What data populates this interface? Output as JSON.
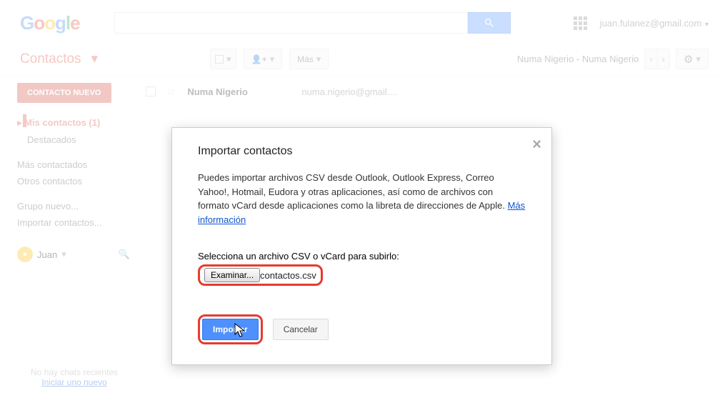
{
  "header": {
    "logo_text": "Google",
    "search_placeholder": "",
    "user_email": "juan.fulanez@gmail.com"
  },
  "app": {
    "title": "Contactos",
    "new_button": "CONTACTO NUEVO",
    "more_label": "Más"
  },
  "sidebar": {
    "items": [
      {
        "label": "Mis contactos (1)",
        "active": true,
        "sub": false
      },
      {
        "label": "Destacados",
        "active": false,
        "sub": true
      },
      {
        "label": "Más contactados",
        "active": false,
        "sub": false
      },
      {
        "label": "Otros contactos",
        "active": false,
        "sub": false
      },
      {
        "label": "Grupo nuevo...",
        "active": false,
        "sub": false
      },
      {
        "label": "Importar contactos...",
        "active": false,
        "sub": false
      }
    ],
    "user_name": "Juan"
  },
  "toolbar_right": {
    "range": "Numa Nigerio - Numa Nigerio"
  },
  "contacts": [
    {
      "name": "Numa Nigerio",
      "email": "numa.nigerio@gmail...."
    }
  ],
  "chat": {
    "no_recent": "No hay chats recientes",
    "start_new": "Iniciar uno nuevo"
  },
  "dialog": {
    "title": "Importar contactos",
    "body_1": "Puedes importar archivos CSV desde Outlook, Outlook Express, Correo Yahoo!, Hotmail, Eudora y otras aplicaciones, así como de archivos con formato vCard desde aplicaciones como la libreta de direcciones de Apple.  ",
    "more_info": "Más información",
    "select_label": "Selecciona un archivo CSV o vCard para subirlo:",
    "browse_label": "Examinar...",
    "filename": "contactos.csv",
    "import_btn": "Importar",
    "cancel_btn": "Cancelar"
  }
}
